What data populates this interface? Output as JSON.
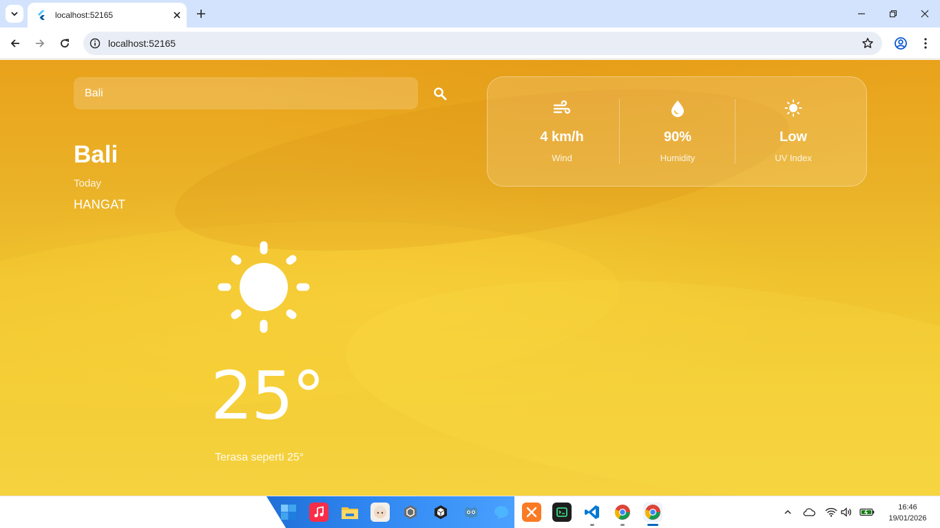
{
  "browser": {
    "tab_title": "localhost:52165",
    "url": "localhost:52165"
  },
  "app": {
    "search": {
      "value": "Bali",
      "placeholder": ""
    },
    "city": "Bali",
    "day_label": "Today",
    "condition": "HANGAT",
    "temperature": "25°",
    "feels_like": "Terasa seperti 25°",
    "weather_icon": "sun-icon",
    "stats": [
      {
        "icon": "wind-icon",
        "value": "4 km/h",
        "label": "Wind"
      },
      {
        "icon": "humidity-drop-icon",
        "value": "90%",
        "label": "Humidity"
      },
      {
        "icon": "uv-sun-icon",
        "value": "Low",
        "label": "UV Index"
      }
    ]
  },
  "taskbar": {
    "apps": [
      "windows-start-icon",
      "music-app-icon",
      "file-explorer-icon",
      "game-character-icon",
      "unity-hub-icon",
      "unity-icon",
      "godot-icon",
      "messaging-app-icon",
      "xampp-icon",
      "terminal-app-icon",
      "vscode-icon",
      "chrome-icon",
      "chrome-active-icon"
    ],
    "clock": {
      "time": "16:46",
      "date": "19/01/2026"
    }
  },
  "colors": {
    "accent": "#0067c0",
    "tabstrip": "#d3e3fd",
    "sand": "#efc22e"
  }
}
